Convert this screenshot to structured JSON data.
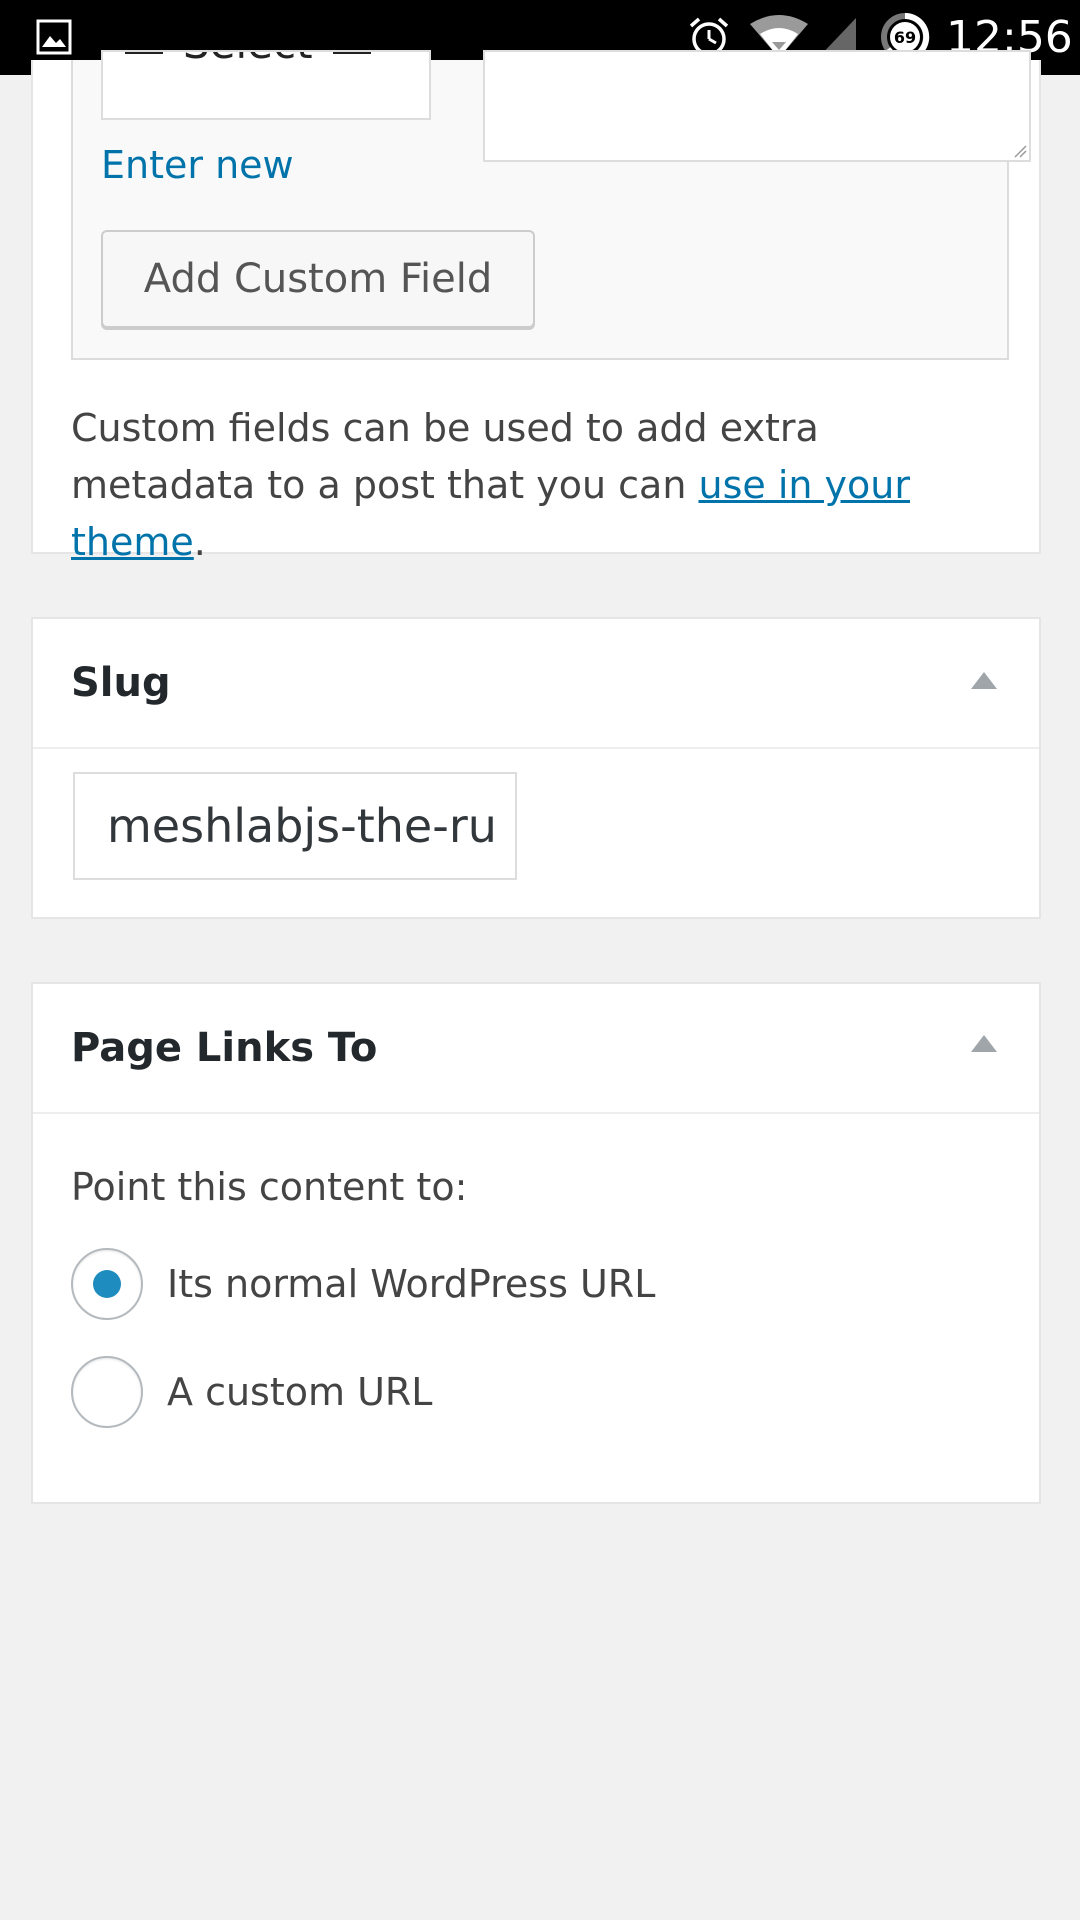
{
  "status_bar": {
    "time": "12:56",
    "battery_level": "69",
    "icons": [
      "gallery-icon",
      "alarm-icon",
      "wifi-icon",
      "signal-icon",
      "battery-icon"
    ]
  },
  "custom_fields": {
    "select_value": "Select",
    "enter_new_label": "Enter new",
    "add_button_label": "Add Custom Field",
    "note_prefix": "Custom fields can be used to add extra metadata to a post that you can ",
    "note_link": "use in your theme",
    "note_suffix": "."
  },
  "slug": {
    "title": "Slug",
    "value": "meshlabjs-the-ru",
    "toggle_icon": "collapse-arrow-icon"
  },
  "page_links": {
    "title": "Page Links To",
    "toggle_icon": "collapse-arrow-icon",
    "point_label": "Point this content to:",
    "options": [
      {
        "label": "Its normal WordPress URL",
        "selected": true
      },
      {
        "label": "A custom URL",
        "selected": false
      }
    ]
  },
  "colors": {
    "accent": "#0073aa",
    "radio_selected": "#1e8cbe",
    "background": "#f1f1f1"
  }
}
